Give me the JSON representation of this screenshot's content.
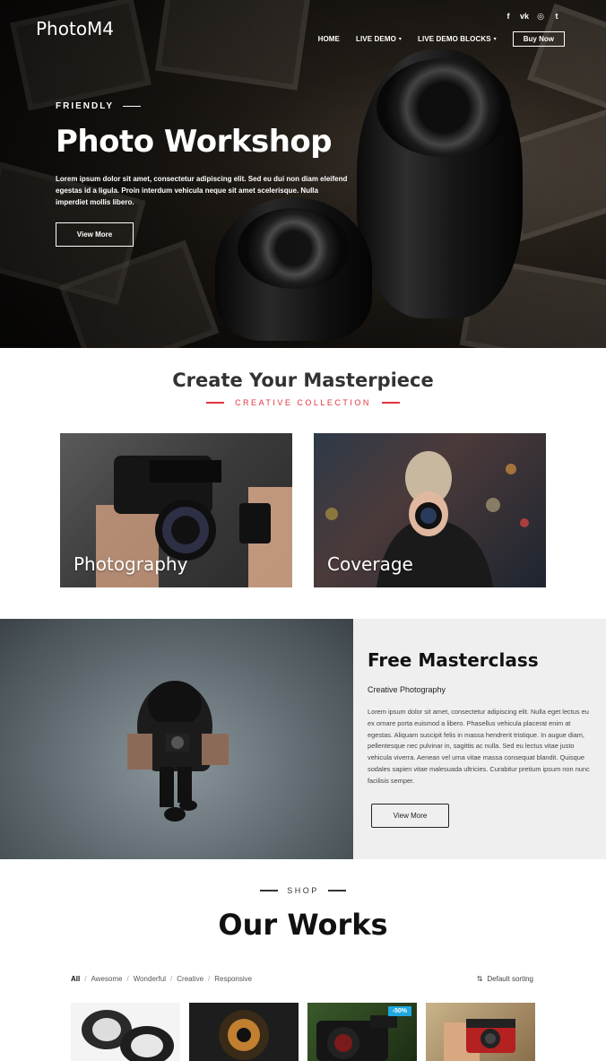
{
  "header": {
    "logo": "PhotoM4",
    "social": [
      {
        "icon": "facebook-icon",
        "glyph": "f"
      },
      {
        "icon": "vk-icon",
        "glyph": "vk"
      },
      {
        "icon": "instagram-icon",
        "glyph": "◎"
      },
      {
        "icon": "twitter-icon",
        "glyph": "t"
      }
    ],
    "nav": [
      {
        "label": "HOME",
        "caret": false
      },
      {
        "label": "LIVE DEMO",
        "caret": true
      },
      {
        "label": "LIVE DEMO BLOCKS",
        "caret": true
      }
    ],
    "buy_label": "Buy Now"
  },
  "hero": {
    "eyebrow": "FRIENDLY",
    "title": "Photo Workshop",
    "text": "Lorem ipsum dolor sit amet, consectetur adipiscing elit. Sed eu dui non diam eleifend egestas id a ligula. Proin interdum vehicula neque sit amet scelerisque. Nulla imperdiet mollis libero.",
    "button": "View More"
  },
  "collection": {
    "title": "Create Your Masterpiece",
    "subtitle": "CREATIVE COLLECTION",
    "cards": [
      {
        "label": "Photography"
      },
      {
        "label": "Coverage"
      }
    ]
  },
  "masterclass": {
    "title": "Free Masterclass",
    "subtitle": "Creative Photography",
    "text": "Lorem ipsum dolor sit amet, consectetur adipiscing elit. Nulla eget lectus eu ex ornare porta euismod a libero. Phasellus vehicula placerat enim at egestas. Aliquam suscipit felis in massa hendrerit tristique. In augue diam, pellentesque nec pulvinar in, sagittis ac nulla. Sed eu lectus vitae justo vehicula viverra. Aenean vel urna vitae massa consequat blandit. Quisque sodales sapien vitae malesuada ultricies. Curabitur pretium ipsum non nunc facilisis semper.",
    "button": "View More"
  },
  "shop": {
    "label": "SHOP",
    "title": "Our Works",
    "filters": [
      "All",
      "Awesome",
      "Wonderful",
      "Creative",
      "Responsive"
    ],
    "sorting": "Default sorting",
    "sale_badge": "-50%"
  },
  "colors": {
    "accent": "#e2333f",
    "badge": "#20a8e0"
  }
}
